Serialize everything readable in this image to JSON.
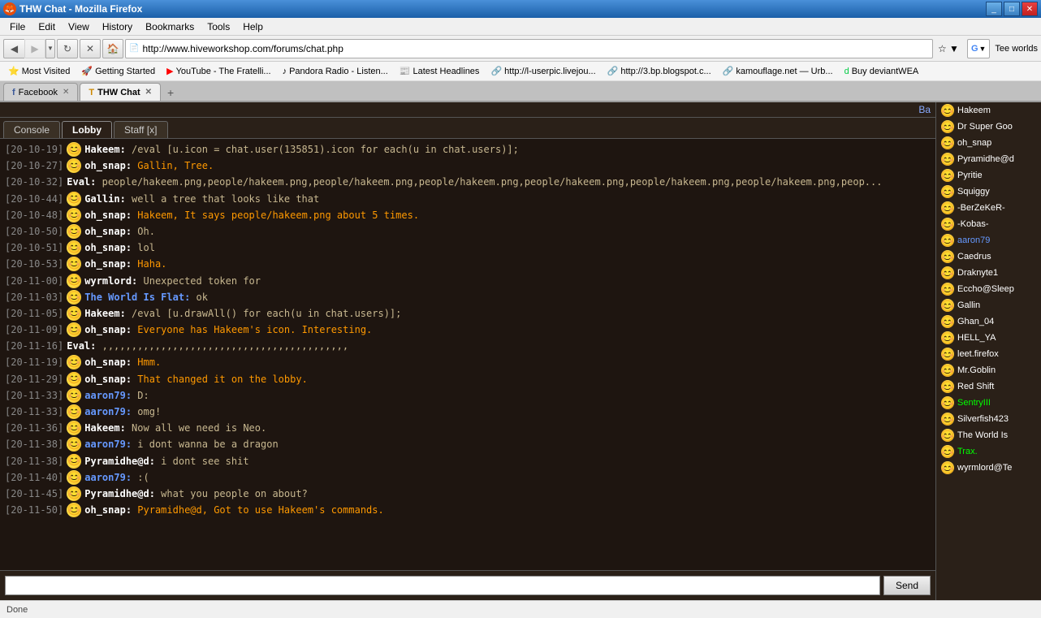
{
  "window": {
    "title": "THW Chat - Mozilla Firefox",
    "icon": "firefox-icon"
  },
  "menu": {
    "items": [
      "File",
      "Edit",
      "View",
      "History",
      "Bookmarks",
      "Tools",
      "Help"
    ]
  },
  "nav": {
    "url": "http://www.hiveworkshop.com/forums/chat.php",
    "user_text": "Tee worlds",
    "back_enabled": true,
    "forward_enabled": false
  },
  "bookmarks": [
    {
      "icon": "⭐",
      "label": "Most Visited"
    },
    {
      "icon": "🚀",
      "label": "Getting Started"
    },
    {
      "icon": "▶",
      "label": "YouTube - The Fratelli..."
    },
    {
      "icon": "♪",
      "label": "Pandora Radio - Listen..."
    },
    {
      "icon": "📰",
      "label": "Latest Headlines"
    },
    {
      "icon": "🔗",
      "label": "http://l-userpic.livejou..."
    },
    {
      "icon": "🔗",
      "label": "http://3.bp.blogspot.c..."
    },
    {
      "icon": "🔗",
      "label": "kamouflage.net — Urb..."
    },
    {
      "icon": "d",
      "label": "Buy deviantWEA"
    }
  ],
  "browser_tabs": [
    {
      "icon": "fb",
      "label": "Facebook",
      "active": false,
      "closeable": true
    },
    {
      "icon": "thw",
      "label": "THW Chat",
      "active": true,
      "closeable": true
    }
  ],
  "chat": {
    "sub_tabs": [
      "Console",
      "Lobby",
      "Staff [x]"
    ],
    "active_tab": "Lobby",
    "extend_label": "Ba",
    "messages": [
      {
        "time": "[20-10-19]",
        "author": "Hakeem:",
        "author_color": "white",
        "text": "/eval [u.icon = chat.user(135851).icon for each(u in chat.users)];",
        "text_color": "normal",
        "has_avatar": true
      },
      {
        "time": "[20-10-27]",
        "author": "oh_snap:",
        "author_color": "white",
        "text": "Gallin, Tree.",
        "text_color": "orange",
        "has_avatar": true
      },
      {
        "time": "[20-10-32]",
        "author": "Eval:",
        "author_color": "white",
        "text": "people/hakeem.png,people/hakeem.png,people/hakeem.png,people/hakeem.png,people/hakeem.png,people/hakeem.png,people/hakeem.png,peop...",
        "text_color": "normal",
        "has_avatar": false
      },
      {
        "time": "[20-10-44]",
        "author": "Gallin:",
        "author_color": "white",
        "text": "well a tree that looks like that",
        "text_color": "normal",
        "has_avatar": true
      },
      {
        "time": "[20-10-48]",
        "author": "oh_snap:",
        "author_color": "white",
        "text": "Hakeem, It says people/hakeem.png about 5 times.",
        "text_color": "orange",
        "has_avatar": true
      },
      {
        "time": "[20-10-50]",
        "author": "oh_snap:",
        "author_color": "white",
        "text": "Oh.",
        "text_color": "normal",
        "has_avatar": true
      },
      {
        "time": "[20-10-51]",
        "author": "oh_snap:",
        "author_color": "white",
        "text": "lol",
        "text_color": "normal",
        "has_avatar": true
      },
      {
        "time": "[20-10-53]",
        "author": "oh_snap:",
        "author_color": "white",
        "text": "Haha.",
        "text_color": "orange",
        "has_avatar": true
      },
      {
        "time": "[20-11-00]",
        "author": "wyrmlord:",
        "author_color": "white",
        "text": "Unexpected token for",
        "text_color": "normal",
        "has_avatar": true
      },
      {
        "time": "[20-11-03]",
        "author": "The World Is Flat:",
        "author_color": "blue",
        "text": "ok",
        "text_color": "normal",
        "has_avatar": true
      },
      {
        "time": "[20-11-05]",
        "author": "Hakeem:",
        "author_color": "white",
        "text": "/eval [u.drawAll() for each(u in chat.users)];",
        "text_color": "normal",
        "has_avatar": true
      },
      {
        "time": "[20-11-09]",
        "author": "oh_snap:",
        "author_color": "white",
        "text": "Everyone has Hakeem's icon. Interesting.",
        "text_color": "orange",
        "has_avatar": true
      },
      {
        "time": "[20-11-16]",
        "author": "Eval:",
        "author_color": "white",
        "text": ",,,,,,,,,,,,,,,,,,,,,,,,,,,,,,,,,,,,,,,,,,",
        "text_color": "normal",
        "has_avatar": false
      },
      {
        "time": "[20-11-19]",
        "author": "oh_snap:",
        "author_color": "white",
        "text": "Hmm.",
        "text_color": "orange",
        "has_avatar": true
      },
      {
        "time": "[20-11-29]",
        "author": "oh_snap:",
        "author_color": "white",
        "text": "That changed it on the lobby.",
        "text_color": "orange",
        "has_avatar": true
      },
      {
        "time": "[20-11-33]",
        "author": "aaron79:",
        "author_color": "blue",
        "text": "D:",
        "text_color": "normal",
        "has_avatar": true
      },
      {
        "time": "[20-11-33]",
        "author": "aaron79:",
        "author_color": "blue",
        "text": "omg!",
        "text_color": "normal",
        "has_avatar": true
      },
      {
        "time": "[20-11-36]",
        "author": "Hakeem:",
        "author_color": "white",
        "text": "Now all we need is Neo.",
        "text_color": "normal",
        "has_avatar": true
      },
      {
        "time": "[20-11-38]",
        "author": "aaron79:",
        "author_color": "blue",
        "text": "i dont wanna be a dragon",
        "text_color": "normal",
        "has_avatar": true
      },
      {
        "time": "[20-11-38]",
        "author": "Pyramidhe@d:",
        "author_color": "white",
        "text": "i dont see shit",
        "text_color": "normal",
        "has_avatar": true
      },
      {
        "time": "[20-11-40]",
        "author": "aaron79:",
        "author_color": "blue",
        "text": ":(",
        "text_color": "normal",
        "has_avatar": true
      },
      {
        "time": "[20-11-45]",
        "author": "Pyramidhe@d:",
        "author_color": "white",
        "text": "what you people on about?",
        "text_color": "normal",
        "has_avatar": true
      },
      {
        "time": "[20-11-50]",
        "author": "oh_snap:",
        "author_color": "white",
        "text": "Pyramidhe@d, Got to use Hakeem's commands.",
        "text_color": "orange",
        "has_avatar": true
      }
    ],
    "input_placeholder": "",
    "send_button": "Send"
  },
  "users": [
    {
      "name": "Hakeem",
      "color": "white"
    },
    {
      "name": "Dr Super Goo",
      "color": "white"
    },
    {
      "name": "oh_snap",
      "color": "white"
    },
    {
      "name": "Pyramidhe@d",
      "color": "white"
    },
    {
      "name": "Pyritie",
      "color": "white"
    },
    {
      "name": "Squiggy",
      "color": "white"
    },
    {
      "name": "-BerZeKeR-",
      "color": "white"
    },
    {
      "name": "-Kobas-",
      "color": "white"
    },
    {
      "name": "aaron79",
      "color": "blue"
    },
    {
      "name": "Caedrus",
      "color": "white"
    },
    {
      "name": "Draknyte1",
      "color": "white"
    },
    {
      "name": "Eccho@Sleep",
      "color": "white"
    },
    {
      "name": "Gallin",
      "color": "white"
    },
    {
      "name": "Ghan_04",
      "color": "white"
    },
    {
      "name": "HELL_YA",
      "color": "white"
    },
    {
      "name": "leet.firefox",
      "color": "white"
    },
    {
      "name": "Mr.Goblin",
      "color": "white"
    },
    {
      "name": "Red Shift",
      "color": "white"
    },
    {
      "name": "SentryIII",
      "color": "green"
    },
    {
      "name": "Silverfish423",
      "color": "white"
    },
    {
      "name": "The World Is",
      "color": "white"
    },
    {
      "name": "Trax.",
      "color": "green"
    },
    {
      "name": "wyrmlord@Te",
      "color": "white"
    }
  ],
  "status_bar": {
    "text": "Done"
  }
}
